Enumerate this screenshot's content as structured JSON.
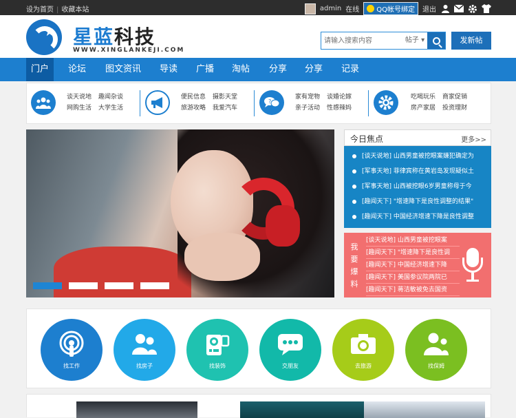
{
  "topbar": {
    "set_home": "设为首页",
    "favorite": "收藏本站",
    "username": "admin",
    "status": "在线",
    "qq_bind": "QQ帐号绑定",
    "logout": "退出"
  },
  "header": {
    "logo_part1": "星蓝",
    "logo_part2": "科技",
    "logo_url": "WWW.XINGLANKEJI.COM",
    "search_placeholder": "请输入搜索内容",
    "search_category": "帖子",
    "post_button": "发新帖"
  },
  "nav": [
    "门户",
    "论坛",
    "图文资讯",
    "导读",
    "广播",
    "淘帖",
    "分享",
    "分享",
    "记录"
  ],
  "categories": [
    {
      "icon": "people-icon",
      "links": [
        "谈天说地",
        "趣闻杂谈",
        "网购生活",
        "大学生活"
      ]
    },
    {
      "icon": "megaphone-icon",
      "links": [
        "便民信息",
        "摄影天堂",
        "旅游攻略",
        "我爱汽车"
      ]
    },
    {
      "icon": "chat-bubbles-icon",
      "links": [
        "家有宠物",
        "谈婚论嫁",
        "亲子活动",
        "性感辣妈"
      ]
    },
    {
      "icon": "gear-icon",
      "links": [
        "吃喝玩乐",
        "商家促销",
        "房产家居",
        "投资理财"
      ]
    }
  ],
  "focus": {
    "title": "今日焦点",
    "more": "更多>>",
    "items": [
      "[谈天说地] 山西男童被挖眼案嫌犯确定为",
      "[军事天地] 菲律宾称在黄岩岛发现疑似土",
      "[军事天地] 山西被挖眼6岁男童称母于今",
      "[趣闻天下] \"增速降下是良性调整的结果\"",
      "[趣闻天下] 中国经济增速下降是良性调整"
    ]
  },
  "tips": {
    "label": "我要爆料",
    "items": [
      "[谈天说地] 山西男童被挖眼案",
      "[趣闻天下] \"增速降下是良性调",
      "[趣闻天下] 中国经济增速下降",
      "[趣闻天下] 美国参议院两院已",
      "[趣闻天下] 蒋洁敏被免去国资"
    ]
  },
  "services": [
    {
      "label": "找工作",
      "icon": "podcast-icon",
      "color": "#1d7fcf"
    },
    {
      "label": "找房子",
      "icon": "user-group-icon",
      "color": "#22a9e8"
    },
    {
      "label": "找装饰",
      "icon": "camcorder-icon",
      "color": "#1fc2b0"
    },
    {
      "label": "交朋友",
      "icon": "chat-icon",
      "color": "#12b9a9"
    },
    {
      "label": "去旅游",
      "icon": "camera-icon",
      "color": "#a6cc19"
    },
    {
      "label": "找保姆",
      "icon": "user-icon",
      "color": "#7bbf21"
    }
  ],
  "colors": {
    "primary": "#1d7fcf",
    "nav_active": "#0d5ca3",
    "tips_bg": "#f26f6f",
    "focus_bg": "#1785c5"
  }
}
